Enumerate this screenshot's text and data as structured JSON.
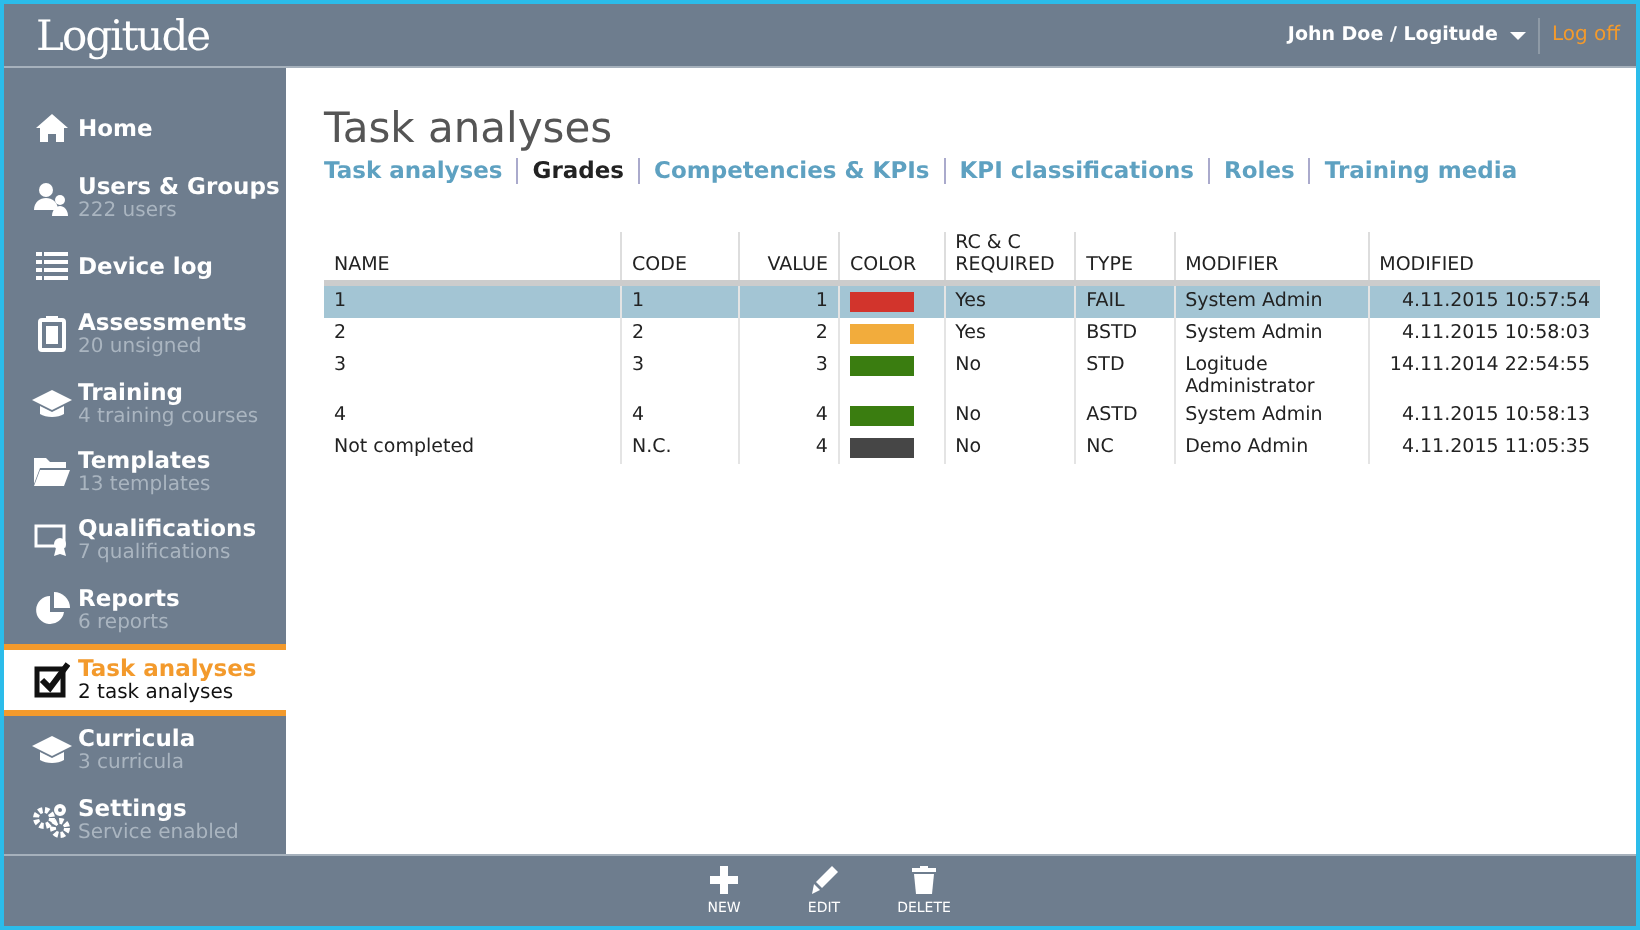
{
  "header": {
    "logo": "Logitude",
    "user": "John Doe / Logitude",
    "logoff": "Log off"
  },
  "sidebar": {
    "items": [
      {
        "kind": "home",
        "label": "Home",
        "selected": false
      },
      {
        "kind": "users",
        "label": "Users & Groups",
        "sub": "222 users",
        "selected": false
      },
      {
        "kind": "list",
        "label": "Device log",
        "selected": false
      },
      {
        "kind": "clipboard",
        "label": "Assessments",
        "sub": "20 unsigned",
        "selected": false
      },
      {
        "kind": "cap",
        "label": "Training",
        "sub": "4 training courses",
        "selected": false
      },
      {
        "kind": "folder",
        "label": "Templates",
        "sub": "13 templates",
        "selected": false
      },
      {
        "kind": "certificate",
        "label": "Qualifications",
        "sub": "7 qualifications",
        "selected": false
      },
      {
        "kind": "pie",
        "label": "Reports",
        "sub": "6 reports",
        "selected": false
      },
      {
        "kind": "checkbox",
        "label": "Task analyses",
        "sub": "2 task analyses",
        "selected": true
      },
      {
        "kind": "cap",
        "label": "Curricula",
        "sub": "3 curricula",
        "selected": false
      },
      {
        "kind": "gears",
        "label": "Settings",
        "sub": "Service enabled",
        "selected": false
      }
    ]
  },
  "page": {
    "title": "Task analyses",
    "tabs": [
      {
        "label": "Task analyses",
        "selected": false
      },
      {
        "label": "Grades",
        "selected": true
      },
      {
        "label": "Competencies & KPIs",
        "selected": false
      },
      {
        "label": "KPI classifications",
        "selected": false
      },
      {
        "label": "Roles",
        "selected": false
      },
      {
        "label": "Training media",
        "selected": false
      }
    ]
  },
  "table": {
    "columns": [
      "NAME",
      "CODE",
      "VALUE",
      "COLOR",
      "RC & C REQUIRED",
      "TYPE",
      "MODIFIER",
      "MODIFIED"
    ],
    "rows": [
      {
        "name": "1",
        "code": "1",
        "value": "1",
        "color": "#d2342c",
        "rc": "Yes",
        "type": "FAIL",
        "modifier": "System Admin",
        "modified": "4.11.2015 10:57:54",
        "selected": true
      },
      {
        "name": "2",
        "code": "2",
        "value": "2",
        "color": "#f2ac3c",
        "rc": "Yes",
        "type": "BSTD",
        "modifier": "System Admin",
        "modified": "4.11.2015 10:58:03",
        "selected": false
      },
      {
        "name": "3",
        "code": "3",
        "value": "3",
        "color": "#3a7d10",
        "rc": "No",
        "type": "STD",
        "modifier": "Logitude Administrator",
        "modified": "14.11.2014 22:54:55",
        "selected": false
      },
      {
        "name": "4",
        "code": "4",
        "value": "4",
        "color": "#3a7d10",
        "rc": "No",
        "type": "ASTD",
        "modifier": "System Admin",
        "modified": "4.11.2015 10:58:13",
        "selected": false
      },
      {
        "name": "Not completed",
        "code": "N.C.",
        "value": "4",
        "color": "#464646",
        "rc": "No",
        "type": "NC",
        "modifier": "Demo Admin",
        "modified": "4.11.2015 11:05:35",
        "selected": false
      }
    ]
  },
  "toolbar": [
    {
      "kind": "plus",
      "label": "NEW"
    },
    {
      "kind": "pencil",
      "label": "EDIT"
    },
    {
      "kind": "trash",
      "label": "DELETE"
    }
  ]
}
